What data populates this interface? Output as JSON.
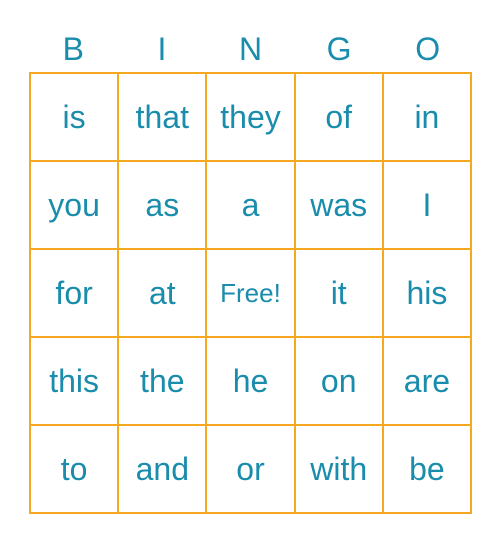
{
  "header": [
    "B",
    "I",
    "N",
    "G",
    "O"
  ],
  "colors": {
    "text": "#1a8cac",
    "border": "#f7a823"
  },
  "rows": [
    [
      "is",
      "that",
      "they",
      "of",
      "in"
    ],
    [
      "you",
      "as",
      "a",
      "was",
      "I"
    ],
    [
      "for",
      "at",
      "Free!",
      "it",
      "his"
    ],
    [
      "this",
      "the",
      "he",
      "on",
      "are"
    ],
    [
      "to",
      "and",
      "or",
      "with",
      "be"
    ]
  ]
}
